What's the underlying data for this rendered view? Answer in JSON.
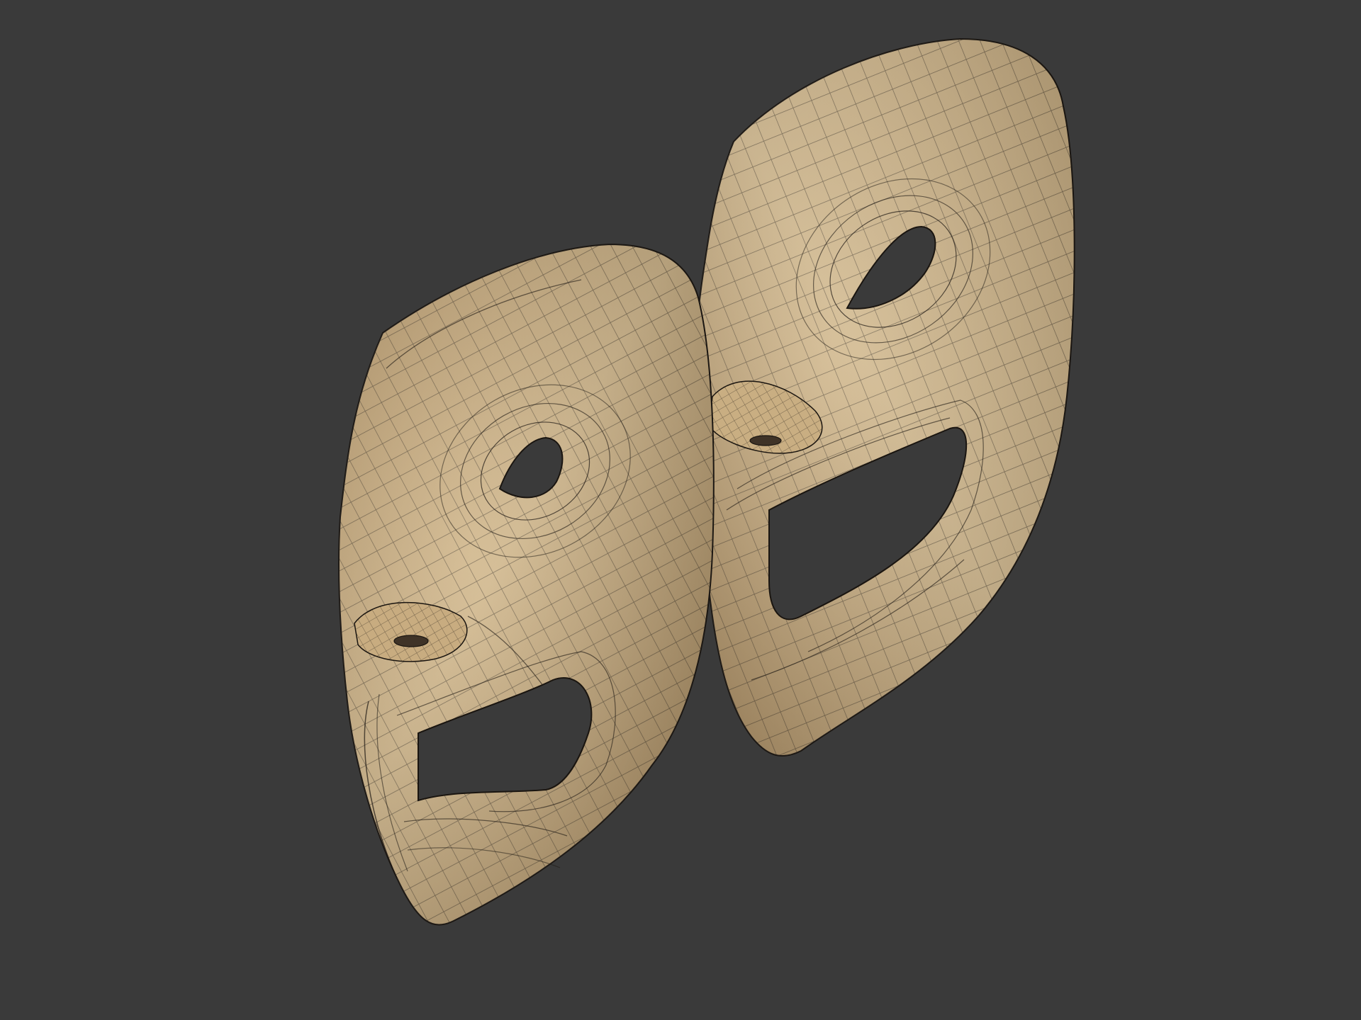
{
  "scene": {
    "background_color": "#3a3a3a",
    "material_color": "#c9ad80",
    "wire_color": "#1c1712",
    "objects": [
      {
        "name": "tragedy-mask",
        "expression": "sad"
      },
      {
        "name": "comedy-mask",
        "expression": "happy"
      }
    ]
  }
}
